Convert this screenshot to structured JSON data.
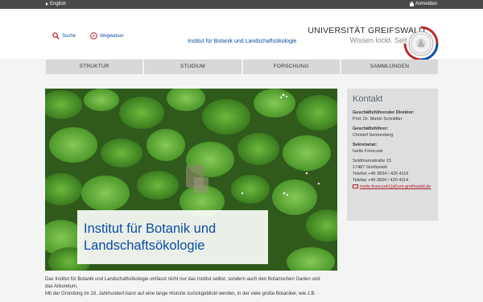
{
  "topbar": {
    "language": "English",
    "login": "Anmelden"
  },
  "header": {
    "search": "Suche",
    "guide": "Wegweiser",
    "institute": "Institut für Botanik und Landschaftsökologie",
    "university": "UNIVERSITÄT GREIFSWALD",
    "slogan": "Wissen lockt. Seit 1456"
  },
  "nav": {
    "items": [
      "STRUKTUR",
      "STUDIUM",
      "FORSCHUNG",
      "SAMMLUNGEN"
    ]
  },
  "hero": {
    "line1": "Institut für Botanik und",
    "line2": "Landschaftsökologie"
  },
  "contact": {
    "title": "Kontakt",
    "director_label": "Geschäftsführender Direktor:",
    "director": "Prof. Dr. Martin Schnittler",
    "manager_label": "Geschäftsführer:",
    "manager": "Christof Sonnenberg",
    "office_label": "Sekretariat:",
    "office": "Ivette Fronczek",
    "street": "Soldmannstraße 15",
    "city": "17487 Greifswald",
    "phone": "Telefon +49 3834 / 420 4116",
    "fax": "Telefax +49 3834 / 420 4114",
    "email": "ivette.fronczek1(at)uni-greifswald.de"
  },
  "intro": {
    "line1": "Das Institut für Botanik und Landschaftsökologie umfasst nicht nur das Institut selbst, sondern auch den Botanischen Garten und",
    "line2": "das Arboretum.",
    "line3": "Mit der Gründung im 18. Jahrhundert kann auf eine lange Historie zurückgeblickt werden, in der viele große Botaniker, wie z.B."
  },
  "colors": {
    "brand_blue": "#0b4ea2",
    "brand_red": "#b0222a",
    "topbar": "#4a4a4a",
    "nav": "#d6d8d9"
  }
}
